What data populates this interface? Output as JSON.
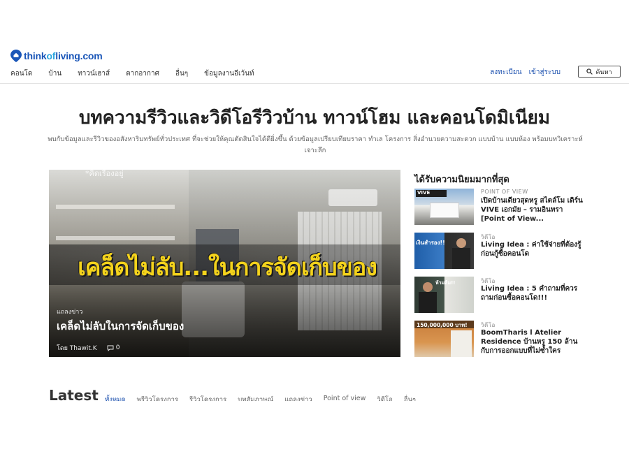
{
  "brand": {
    "name_part1": "think",
    "name_part2": "of",
    "name_part3": "living.com",
    "color_primary": "#1a56b8",
    "color_secondary": "#2aa5df"
  },
  "nav": {
    "items": [
      {
        "label": "คอนโด"
      },
      {
        "label": "บ้าน"
      },
      {
        "label": "ทาวน์เฮาส์"
      },
      {
        "label": "ตากอากาศ"
      },
      {
        "label": "อื่นๆ"
      },
      {
        "label": "ข้อมูลงานอีเว้นท์"
      }
    ],
    "register": "ลงทะเบียน",
    "login": "เข้าสู่ระบบ",
    "search_label": "ค้นหา",
    "search_icon": "search-icon"
  },
  "hero": {
    "title": "บทความรีวิวและวิดีโอรีวิวบ้าน ทาวน์โฮม และคอนโดมิเนียม",
    "subtitle": "พบกับข้อมูลและรีวิวของอสังหาริมทรัพย์ทั่วประเทศ ที่จะช่วยให้คุณตัดสินใจได้ดียิ่งขึ้น ด้วยข้อมูลเปรียบเทียบราคา ทำเล โครงการ สิ่งอำนวยความสะดวก แบบบ้าน แบบห้อง พร้อมบทวิเคราะห์เจาะลึก"
  },
  "featured": {
    "watermark": "*คิดเรื่องอยู่",
    "banner": "เคล็ดไม่ลับ...ในการจัดเก็บของ",
    "category": "แถลงข่าว",
    "title": "เคล็ดไม่ลับในการจัดเก็บของ",
    "author": "โดย Thawit.K",
    "comments": "0"
  },
  "popular": {
    "heading": "ได้รับความนิยมมากที่สุด",
    "items": [
      {
        "category": "POINT OF VIEW",
        "title": "เปิดบ้านเดียวสุดหรู สไตล์โม เดิร์น VIVE เอกมัย – รามอินทรา [Point of View..."
      },
      {
        "category": "วิดีโอ",
        "title": "Living Idea : ค่าใช้จ่ายที่ต้องรู้ ก่อนกู้ซื้อคอนโด"
      },
      {
        "category": "วิดีโอ",
        "title": "Living Idea : 5 คำถามที่ควร ถามก่อนซื้อคอนโด!!!"
      },
      {
        "category": "วิดีโอ",
        "title": "BoomTharis l Atelier Residence บ้านหรู 150 ล้าน กับการออกแบบที่ไม่ซ้ำใคร"
      }
    ],
    "thumb_texts": [
      "VIVE",
      "เงินสำรอง!!",
      "ห้ามลืม!!",
      "150,000,000 บาท!"
    ]
  },
  "latest": {
    "heading": "Latest",
    "tabs": [
      {
        "label": "ทั้งหมด"
      },
      {
        "label": "พรีวิวโครงการ"
      },
      {
        "label": "รีวิวโครงการ"
      },
      {
        "label": "บทสัมภาษณ์"
      },
      {
        "label": "แถลงข่าว"
      },
      {
        "label": "Point of view"
      },
      {
        "label": "วิดีโอ"
      },
      {
        "label": "อื่นๆ"
      }
    ]
  }
}
